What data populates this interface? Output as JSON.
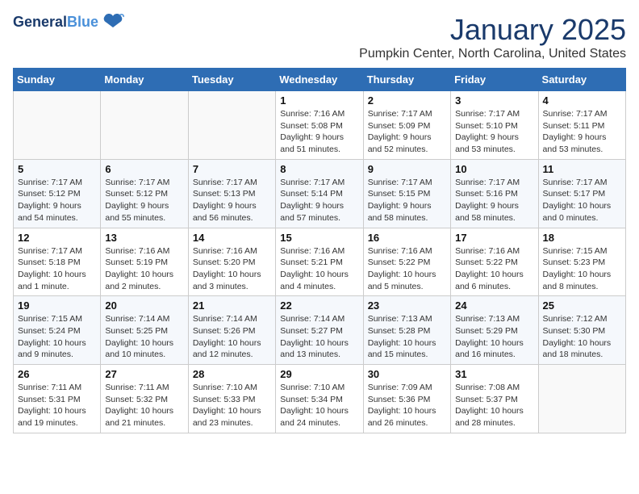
{
  "logo": {
    "general": "General",
    "blue": "Blue"
  },
  "title": "January 2025",
  "subtitle": "Pumpkin Center, North Carolina, United States",
  "weekdays": [
    "Sunday",
    "Monday",
    "Tuesday",
    "Wednesday",
    "Thursday",
    "Friday",
    "Saturday"
  ],
  "weeks": [
    [
      {
        "day": "",
        "info": ""
      },
      {
        "day": "",
        "info": ""
      },
      {
        "day": "",
        "info": ""
      },
      {
        "day": "1",
        "info": "Sunrise: 7:16 AM\nSunset: 5:08 PM\nDaylight: 9 hours and 51 minutes."
      },
      {
        "day": "2",
        "info": "Sunrise: 7:17 AM\nSunset: 5:09 PM\nDaylight: 9 hours and 52 minutes."
      },
      {
        "day": "3",
        "info": "Sunrise: 7:17 AM\nSunset: 5:10 PM\nDaylight: 9 hours and 53 minutes."
      },
      {
        "day": "4",
        "info": "Sunrise: 7:17 AM\nSunset: 5:11 PM\nDaylight: 9 hours and 53 minutes."
      }
    ],
    [
      {
        "day": "5",
        "info": "Sunrise: 7:17 AM\nSunset: 5:12 PM\nDaylight: 9 hours and 54 minutes."
      },
      {
        "day": "6",
        "info": "Sunrise: 7:17 AM\nSunset: 5:12 PM\nDaylight: 9 hours and 55 minutes."
      },
      {
        "day": "7",
        "info": "Sunrise: 7:17 AM\nSunset: 5:13 PM\nDaylight: 9 hours and 56 minutes."
      },
      {
        "day": "8",
        "info": "Sunrise: 7:17 AM\nSunset: 5:14 PM\nDaylight: 9 hours and 57 minutes."
      },
      {
        "day": "9",
        "info": "Sunrise: 7:17 AM\nSunset: 5:15 PM\nDaylight: 9 hours and 58 minutes."
      },
      {
        "day": "10",
        "info": "Sunrise: 7:17 AM\nSunset: 5:16 PM\nDaylight: 9 hours and 58 minutes."
      },
      {
        "day": "11",
        "info": "Sunrise: 7:17 AM\nSunset: 5:17 PM\nDaylight: 10 hours and 0 minutes."
      }
    ],
    [
      {
        "day": "12",
        "info": "Sunrise: 7:17 AM\nSunset: 5:18 PM\nDaylight: 10 hours and 1 minute."
      },
      {
        "day": "13",
        "info": "Sunrise: 7:16 AM\nSunset: 5:19 PM\nDaylight: 10 hours and 2 minutes."
      },
      {
        "day": "14",
        "info": "Sunrise: 7:16 AM\nSunset: 5:20 PM\nDaylight: 10 hours and 3 minutes."
      },
      {
        "day": "15",
        "info": "Sunrise: 7:16 AM\nSunset: 5:21 PM\nDaylight: 10 hours and 4 minutes."
      },
      {
        "day": "16",
        "info": "Sunrise: 7:16 AM\nSunset: 5:22 PM\nDaylight: 10 hours and 5 minutes."
      },
      {
        "day": "17",
        "info": "Sunrise: 7:16 AM\nSunset: 5:22 PM\nDaylight: 10 hours and 6 minutes."
      },
      {
        "day": "18",
        "info": "Sunrise: 7:15 AM\nSunset: 5:23 PM\nDaylight: 10 hours and 8 minutes."
      }
    ],
    [
      {
        "day": "19",
        "info": "Sunrise: 7:15 AM\nSunset: 5:24 PM\nDaylight: 10 hours and 9 minutes."
      },
      {
        "day": "20",
        "info": "Sunrise: 7:14 AM\nSunset: 5:25 PM\nDaylight: 10 hours and 10 minutes."
      },
      {
        "day": "21",
        "info": "Sunrise: 7:14 AM\nSunset: 5:26 PM\nDaylight: 10 hours and 12 minutes."
      },
      {
        "day": "22",
        "info": "Sunrise: 7:14 AM\nSunset: 5:27 PM\nDaylight: 10 hours and 13 minutes."
      },
      {
        "day": "23",
        "info": "Sunrise: 7:13 AM\nSunset: 5:28 PM\nDaylight: 10 hours and 15 minutes."
      },
      {
        "day": "24",
        "info": "Sunrise: 7:13 AM\nSunset: 5:29 PM\nDaylight: 10 hours and 16 minutes."
      },
      {
        "day": "25",
        "info": "Sunrise: 7:12 AM\nSunset: 5:30 PM\nDaylight: 10 hours and 18 minutes."
      }
    ],
    [
      {
        "day": "26",
        "info": "Sunrise: 7:11 AM\nSunset: 5:31 PM\nDaylight: 10 hours and 19 minutes."
      },
      {
        "day": "27",
        "info": "Sunrise: 7:11 AM\nSunset: 5:32 PM\nDaylight: 10 hours and 21 minutes."
      },
      {
        "day": "28",
        "info": "Sunrise: 7:10 AM\nSunset: 5:33 PM\nDaylight: 10 hours and 23 minutes."
      },
      {
        "day": "29",
        "info": "Sunrise: 7:10 AM\nSunset: 5:34 PM\nDaylight: 10 hours and 24 minutes."
      },
      {
        "day": "30",
        "info": "Sunrise: 7:09 AM\nSunset: 5:36 PM\nDaylight: 10 hours and 26 minutes."
      },
      {
        "day": "31",
        "info": "Sunrise: 7:08 AM\nSunset: 5:37 PM\nDaylight: 10 hours and 28 minutes."
      },
      {
        "day": "",
        "info": ""
      }
    ]
  ]
}
